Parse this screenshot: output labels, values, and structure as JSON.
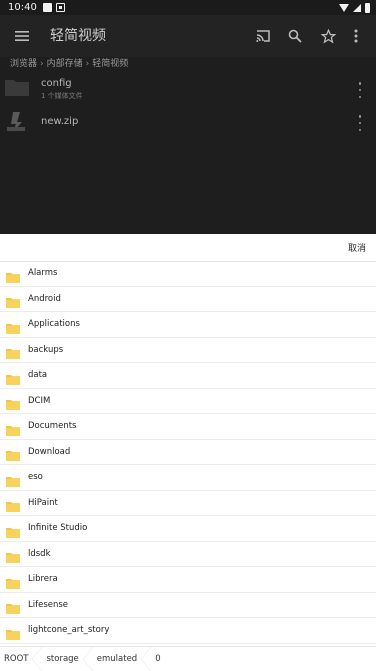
{
  "status_bar": {
    "time": "10:40"
  },
  "toolbar": {
    "title": "轻简视频"
  },
  "breadcrumb": [
    "浏览器",
    "内部存储",
    "轻简视频"
  ],
  "files": [
    {
      "name": "config",
      "subtitle": "1 个媒体文件",
      "icon": "folder-icon"
    },
    {
      "name": "new.zip",
      "subtitle": "",
      "icon": "zip-icon"
    }
  ],
  "sheet": {
    "cancel_label": "取消",
    "folders": [
      "Alarms",
      "Android",
      "Applications",
      "backups",
      "data",
      "DCIM",
      "Documents",
      "Download",
      "eso",
      "HiPaint",
      "Infinite Studio",
      "ldsdk",
      "Librera",
      "Lifesense",
      "lightcone_art_story"
    ],
    "path": [
      "ROOT",
      "storage",
      "emulated",
      "0"
    ]
  },
  "colors": {
    "app_background": "#1e1e1e",
    "folder_yellow": "#f4c542",
    "sheet_background": "#ffffff"
  }
}
